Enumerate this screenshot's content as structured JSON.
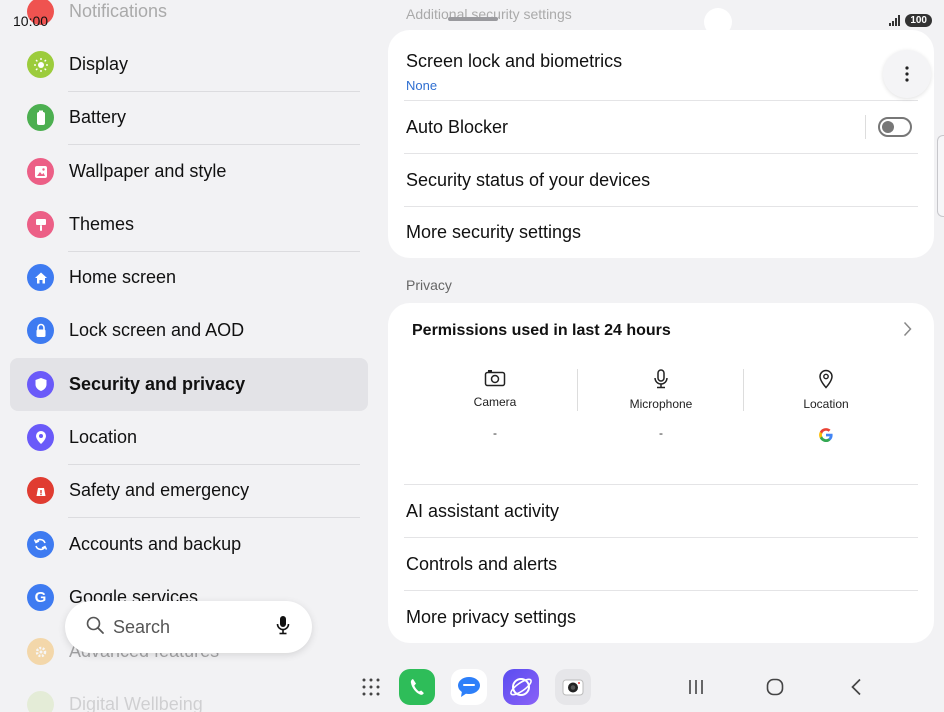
{
  "status": {
    "time": "10:00",
    "battery": "100"
  },
  "sidebar": {
    "items": [
      {
        "label": "Notifications",
        "color": "#ef5350",
        "icon": "bell-icon"
      },
      {
        "label": "Display",
        "color": "#9ccc3c",
        "icon": "sun-icon"
      },
      {
        "label": "Battery",
        "color": "#4caf50",
        "icon": "battery-icon"
      },
      {
        "label": "Wallpaper and style",
        "color": "#ec5f86",
        "icon": "image-icon"
      },
      {
        "label": "Themes",
        "color": "#ec5f86",
        "icon": "brush-icon"
      },
      {
        "label": "Home screen",
        "color": "#3e7bf1",
        "icon": "home-icon"
      },
      {
        "label": "Lock screen and AOD",
        "color": "#3e7bf1",
        "icon": "lock-icon"
      },
      {
        "label": "Security and privacy",
        "color": "#6a5af9",
        "icon": "shield-icon"
      },
      {
        "label": "Location",
        "color": "#6a5af9",
        "icon": "location-pin-icon"
      },
      {
        "label": "Safety and emergency",
        "color": "#e03c31",
        "icon": "emergency-icon"
      },
      {
        "label": "Accounts and backup",
        "color": "#3e7bf1",
        "icon": "sync-icon"
      },
      {
        "label": "Google services",
        "color": "#3e7bf1",
        "icon": "google-icon"
      },
      {
        "label": "Advanced features",
        "color": "#f5a623",
        "icon": "gear-icon"
      },
      {
        "label": "Digital Wellbeing",
        "color": "#9ccc3c",
        "icon": "wellbeing-icon"
      }
    ],
    "search": {
      "placeholder": "Search"
    }
  },
  "security": {
    "section_title": "Additional security settings",
    "rows": {
      "screen_lock": {
        "title": "Screen lock and biometrics",
        "subtitle": "None"
      },
      "auto_blocker": {
        "title": "Auto Blocker",
        "enabled": false
      },
      "device_status": {
        "title": "Security status of your devices"
      },
      "more": {
        "title": "More security settings"
      }
    }
  },
  "privacy": {
    "section_title": "Privacy",
    "permissions": {
      "title": "Permissions used in last 24 hours",
      "items": [
        {
          "label": "Camera",
          "value": "-"
        },
        {
          "label": "Microphone",
          "value": "-"
        },
        {
          "label": "Location",
          "value": "",
          "app": "google-icon"
        }
      ]
    },
    "rows": {
      "ai": "AI assistant activity",
      "controls": "Controls and alerts",
      "more": "More privacy settings"
    }
  },
  "dock": {
    "apps": [
      "Phone",
      "Messages",
      "Internet",
      "Camera"
    ]
  }
}
